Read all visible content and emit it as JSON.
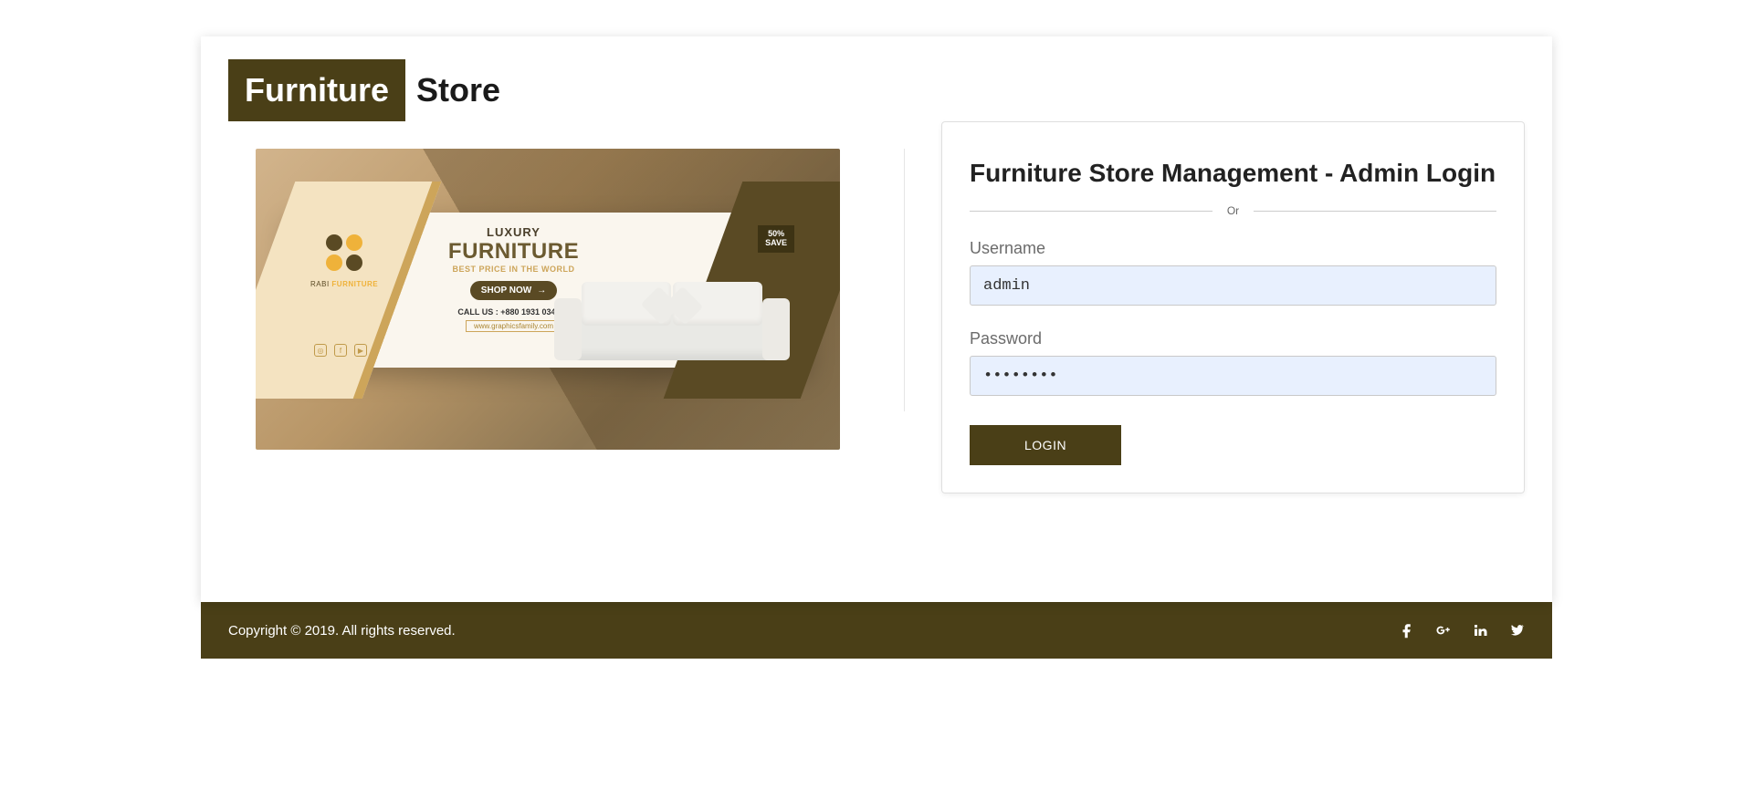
{
  "logo": {
    "boxed": "Furniture",
    "plain": "Store"
  },
  "promo": {
    "brand_line1": "RABI",
    "brand_line2": "FURNITURE",
    "luxury": "LUXURY",
    "furniture": "FURNITURE",
    "tagline": "BEST PRICE IN THE WORLD",
    "shop_now": "SHOP NOW",
    "call_us": "CALL US : +880 1931 034992",
    "website": "www.graphicsfamily.com",
    "save_pct": "50%",
    "save_label": "SAVE"
  },
  "login": {
    "title": "Furniture Store Management - Admin Login",
    "divider": "Or",
    "username_label": "Username",
    "username_value": "admin",
    "password_label": "Password",
    "password_value": "••••••••",
    "button": "LOGIN"
  },
  "footer": {
    "copyright": "Copyright © 2019. All rights reserved."
  },
  "colors": {
    "brand_dark": "#4a3f17",
    "input_bg": "#e8f0fe"
  }
}
